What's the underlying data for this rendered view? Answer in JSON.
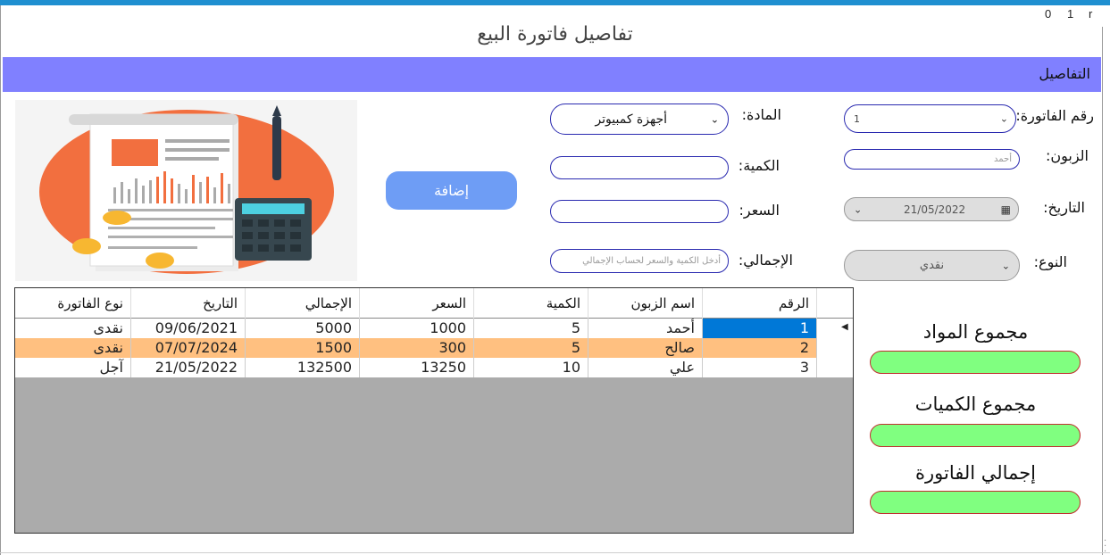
{
  "window": {
    "controls": [
      "0",
      "1",
      "r"
    ]
  },
  "title": "تفاصيل فاتورة البيع",
  "section_label": "التفاصيل",
  "form": {
    "invoice_number": {
      "label": "رقم الفاتورة:",
      "value": "1"
    },
    "customer": {
      "label": "الزبون:",
      "placeholder": "أحمد"
    },
    "date": {
      "label": "التاريخ:",
      "value": "21/05/2022"
    },
    "type": {
      "label": "النوع:",
      "value": "نقدي"
    },
    "material": {
      "label": "المادة:",
      "value": "أجهزة كمبيوتر"
    },
    "quantity": {
      "label": "الكمية:",
      "value": ""
    },
    "price": {
      "label": "السعر:",
      "value": ""
    },
    "total": {
      "label": "الإجمالي:",
      "placeholder": "أدخل الكمية والسعر لحساب الإجمالي"
    }
  },
  "add_button": "إضافة",
  "table": {
    "headers": [
      "الرقم",
      "اسم الزبون",
      "الكمية",
      "السعر",
      "الإجمالي",
      "التاريخ",
      "نوع الفاتورة"
    ],
    "rows": [
      [
        "1",
        "أحمد",
        "5",
        "1000",
        "5000",
        "09/06/2021",
        "نقدى"
      ],
      [
        "2",
        "صالح",
        "5",
        "300",
        "1500",
        "07/07/2024",
        "نقدى"
      ],
      [
        "3",
        "علي",
        "10",
        "13250",
        "132500",
        "21/05/2022",
        "آجل"
      ]
    ],
    "selected_row_color": "#ffc080",
    "selected_cell_color": "#0078d7"
  },
  "summary": {
    "items_label": "مجموع المواد",
    "quantities_label": "مجموع الكميات",
    "invoice_total_label": "إجمالي الفاتورة",
    "box_color": "#80ff80"
  },
  "colors": {
    "band": "#8080ff",
    "add_button": "#6e9df5",
    "grid_empty": "#ababab"
  },
  "icons": {
    "dropdown": "chevron-down-icon",
    "calendar": "calendar-icon",
    "row_pointer": "row-pointer-icon"
  }
}
